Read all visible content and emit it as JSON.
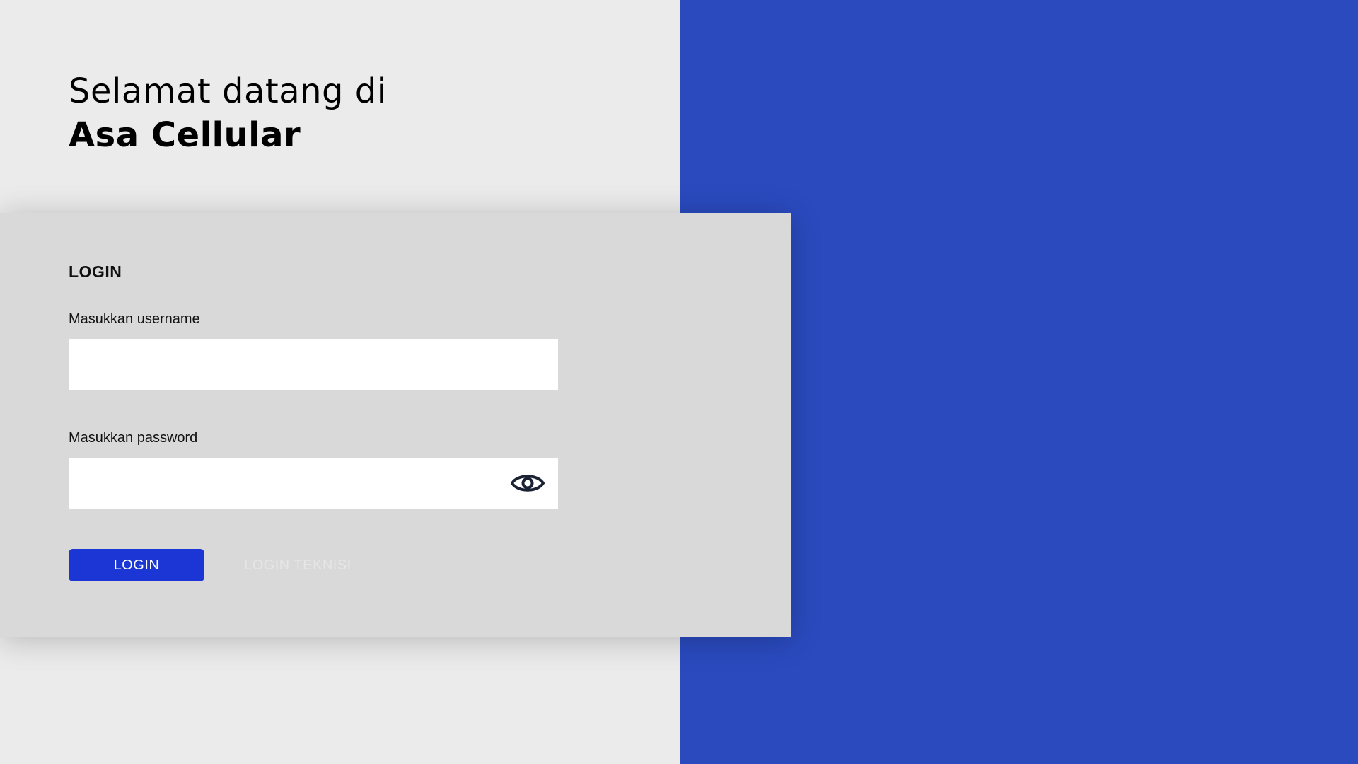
{
  "welcome": {
    "line1": "Selamat datang di",
    "line2": "Asa Cellular"
  },
  "login_card": {
    "title": "LOGIN",
    "username_label": "Masukkan username",
    "username_value": "",
    "password_label": "Masukkan password",
    "password_value": "",
    "password_toggle_icon": "eye-icon",
    "login_button": "LOGIN",
    "technician_button": "LOGIN TEKNISI"
  },
  "colors": {
    "left_background": "#ebebeb",
    "right_background": "#2a4abe",
    "card_background": "#d9d9d9",
    "primary_button": "#1c36d6"
  }
}
